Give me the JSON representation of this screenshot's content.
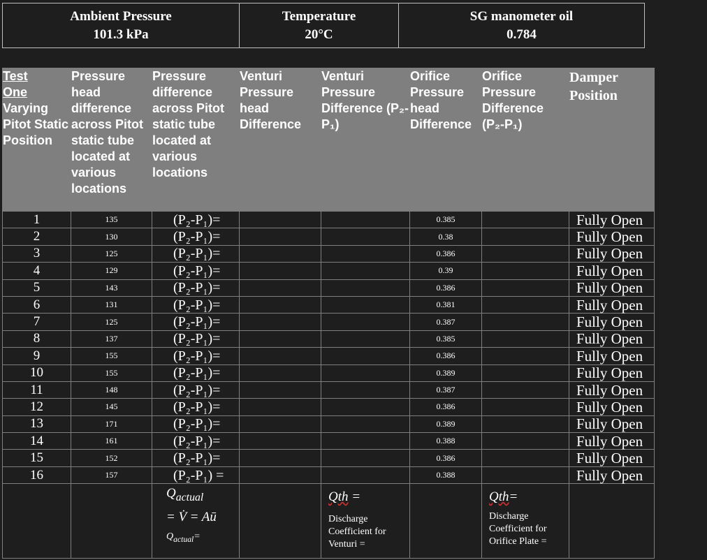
{
  "top": {
    "ambient_label": "Ambient Pressure",
    "ambient_value": "101.3 kPa",
    "temp_label": "Temperature",
    "temp_value": "20°C",
    "sg_label": "SG manometer oil",
    "sg_value": "0.784"
  },
  "headers": {
    "test_u1": "Test",
    "test_u2": "One",
    "test_rest": "Varying Pitot Static Position",
    "pitot_head": "Pressure head difference across Pitot static tube located at various locations",
    "pitot_diff": "Pressure difference across Pitot static tube located at various locations",
    "venturi_head": "Venturi Pressure head Difference",
    "venturi_diff": "Venturi Pressure Difference (P₂-P₁)",
    "orifice_head": "Orifice Pressure head Difference",
    "orifice_diff": "Orifice Pressure Difference (P₂-P₁)",
    "damper": "Damper Position"
  },
  "rows": [
    {
      "n": "1",
      "pitot": "135",
      "eq": "(P₂-P₁)=",
      "orifice": "0.385",
      "damper": "Fully Open"
    },
    {
      "n": "2",
      "pitot": "130",
      "eq": "(P₂-P₁)=",
      "orifice": "0.38",
      "damper": "Fully Open"
    },
    {
      "n": "3",
      "pitot": "125",
      "eq": "(P₂-P₁)=",
      "orifice": "0.386",
      "damper": "Fully Open"
    },
    {
      "n": "4",
      "pitot": "129",
      "eq": "(P₂-P₁)=",
      "orifice": "0.39",
      "damper": "Fully Open"
    },
    {
      "n": "5",
      "pitot": "143",
      "eq": "(P₂-P₁)=",
      "orifice": "0.386",
      "damper": "Fully Open"
    },
    {
      "n": "6",
      "pitot": "131",
      "eq": "(P₂-P₁)=",
      "orifice": "0.381",
      "damper": "Fully Open"
    },
    {
      "n": "7",
      "pitot": "125",
      "eq": "(P₂-P₁)=",
      "orifice": "0.387",
      "damper": "Fully Open"
    },
    {
      "n": "8",
      "pitot": "137",
      "eq": "(P₂-P₁)=",
      "orifice": "0.385",
      "damper": "Fully Open"
    },
    {
      "n": "9",
      "pitot": "155",
      "eq": "(P₂-P₁)=",
      "orifice": "0.386",
      "damper": "Fully Open"
    },
    {
      "n": "10",
      "pitot": "155",
      "eq": "(P₂-P₁)=",
      "orifice": "0.389",
      "damper": "Fully Open"
    },
    {
      "n": "11",
      "pitot": "148",
      "eq": "(P₂-P₁)=",
      "orifice": "0.387",
      "damper": "Fully Open"
    },
    {
      "n": "12",
      "pitot": "145",
      "eq": "(P₂-P₁)=",
      "orifice": "0.386",
      "damper": "Fully Open"
    },
    {
      "n": "13",
      "pitot": "171",
      "eq": "(P₂-P₁)=",
      "orifice": "0.389",
      "damper": "Fully Open"
    },
    {
      "n": "14",
      "pitot": "161",
      "eq": "(P₂-P₁)=",
      "orifice": "0.388",
      "damper": "Fully Open"
    },
    {
      "n": "15",
      "pitot": "152",
      "eq": "(P₂-P₁)=",
      "orifice": "0.386",
      "damper": "Fully Open"
    },
    {
      "n": "16",
      "pitot": "157",
      "eq": "(P₂-P₁) =",
      "orifice": "0.388",
      "damper": "Fully Open"
    }
  ],
  "footer": {
    "q_actual": "Q",
    "q_actual_sub": "actual",
    "v_eq": "= V̇ = Aū",
    "q_actual2": "Q",
    "q_actual2_sub": "actual",
    "q_actual2_eq": "=",
    "venturi_qth": "Q",
    "venturi_qth_sub": "th",
    "venturi_qth_eq": " =",
    "venturi_dc": "Discharge Coefficient for Venturi =",
    "orifice_qth": "Q",
    "orifice_qth_sub": "th",
    "orifice_qth_eq": "=",
    "orifice_dc": "Discharge Coefficient for Orifice Plate ="
  }
}
